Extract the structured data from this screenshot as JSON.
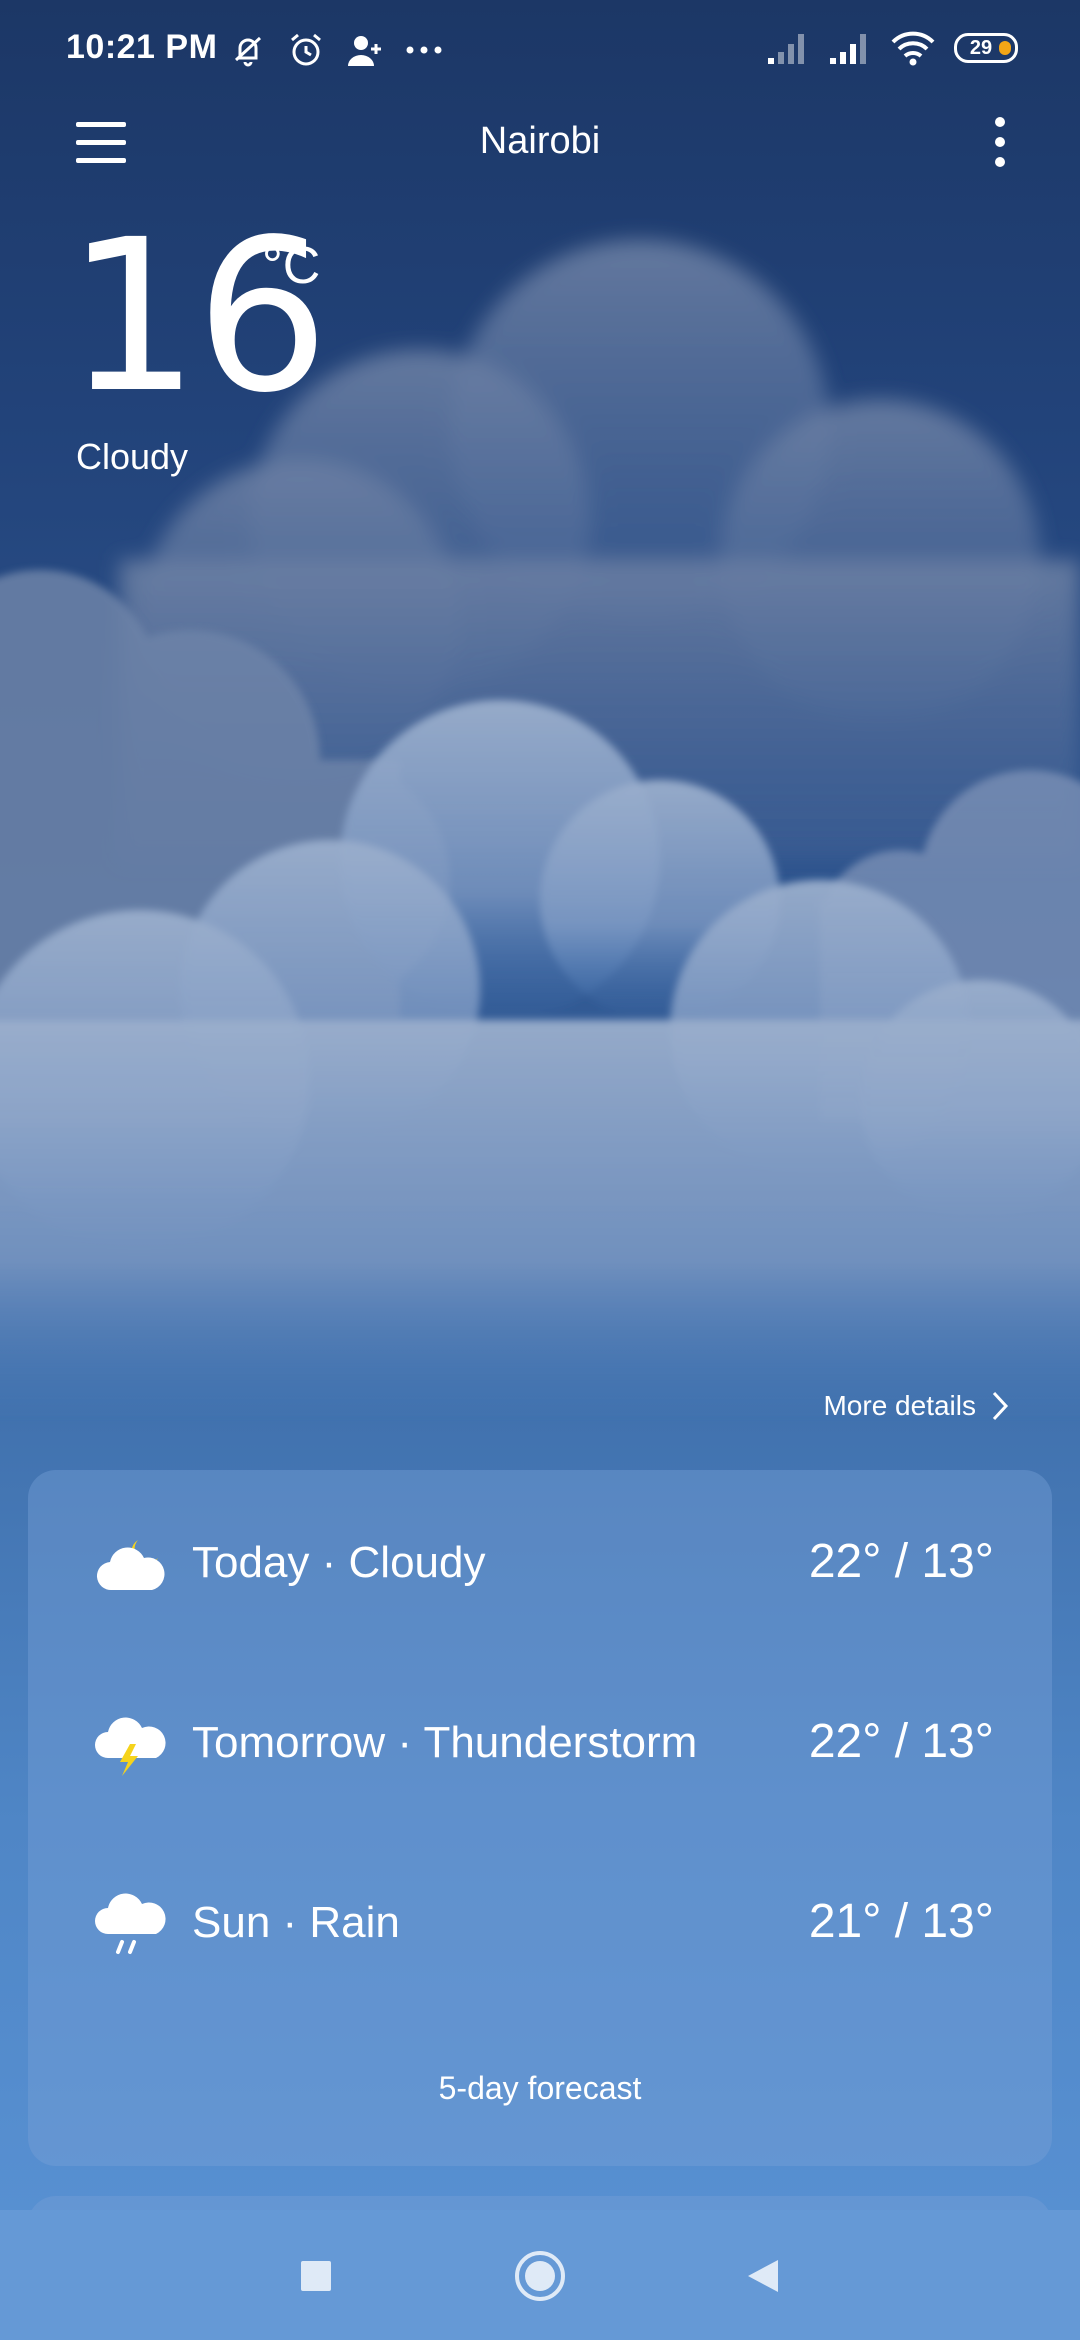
{
  "status_bar": {
    "time": "10:21 PM",
    "left_icons": [
      "vibrate-mute-icon",
      "alarm-icon",
      "add-contact-icon",
      "more-dots-icon"
    ],
    "right_icons": [
      "signal-1-icon",
      "signal-2-icon",
      "wifi-icon"
    ],
    "battery": "29"
  },
  "header": {
    "city": "Nairobi"
  },
  "current": {
    "temperature": "16",
    "unit": "°C",
    "condition": "Cloudy"
  },
  "more_details": "More details",
  "forecast": {
    "rows": [
      {
        "label": "Today · Cloudy",
        "temps": "22° / 13°",
        "icon": "cloud-moon-icon"
      },
      {
        "label": "Tomorrow · Thunderstorm",
        "temps": "22° / 13°",
        "icon": "thunderstorm-icon"
      },
      {
        "label": "Sun · Rain",
        "temps": "21° / 13°",
        "icon": "rain-icon"
      }
    ],
    "five_day": "5-day forecast"
  },
  "colors": {
    "sky_top": "#1c3766",
    "sky_bottom": "#5a93d5",
    "accent_moon": "#f5d31c",
    "battery_fill": "#f2a516"
  }
}
